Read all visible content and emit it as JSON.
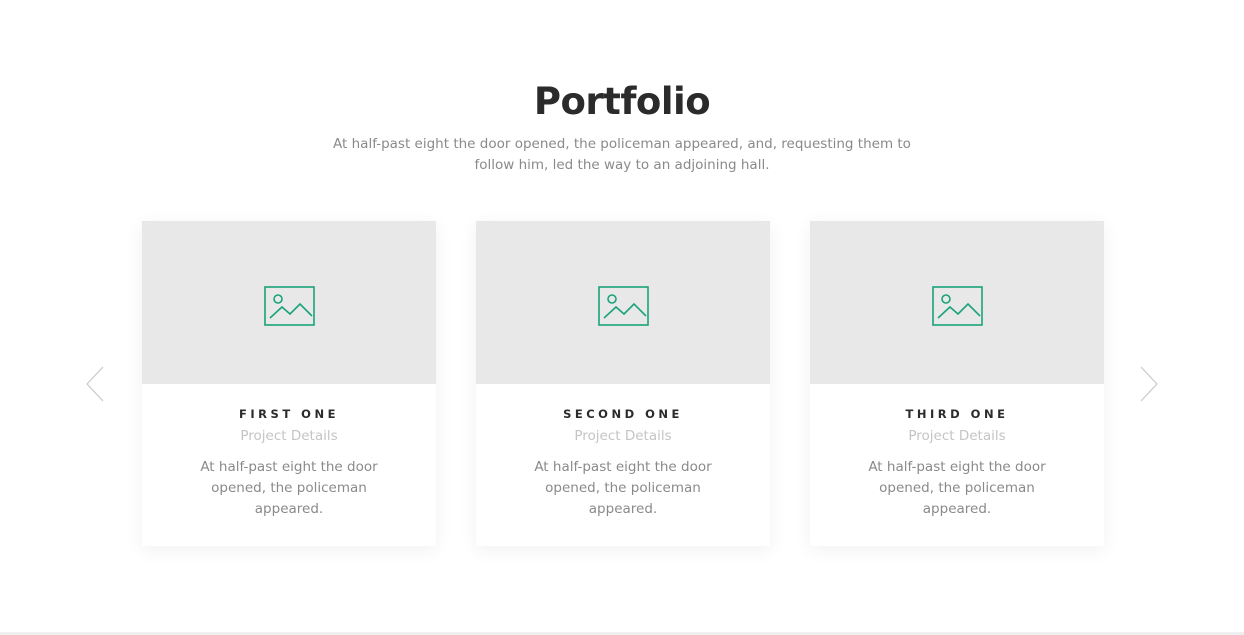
{
  "section": {
    "title": "Portfolio",
    "subtitle": "At half-past eight the door opened, the policeman appeared, and, requesting them to follow him, led the way to an adjoining hall."
  },
  "carousel": {
    "prev_icon": "chevron-left-icon",
    "next_icon": "chevron-right-icon",
    "cards": [
      {
        "title": "FIRST ONE",
        "subtitle": "Project Details",
        "text": "At half-past eight the door opened, the policeman appeared.",
        "icon": "image-placeholder-icon"
      },
      {
        "title": "SECOND ONE",
        "subtitle": "Project Details",
        "text": "At half-past eight the door opened, the policeman appeared.",
        "icon": "image-placeholder-icon"
      },
      {
        "title": "THIRD ONE",
        "subtitle": "Project Details",
        "text": "At half-past eight the door opened, the policeman appeared.",
        "icon": "image-placeholder-icon"
      }
    ]
  },
  "colors": {
    "accent": "#1aa37a",
    "placeholder_bg": "#e8e8e8",
    "heading": "#2b2b2b",
    "body_text": "#8a8a8a",
    "muted_text": "#c4c4c4"
  }
}
